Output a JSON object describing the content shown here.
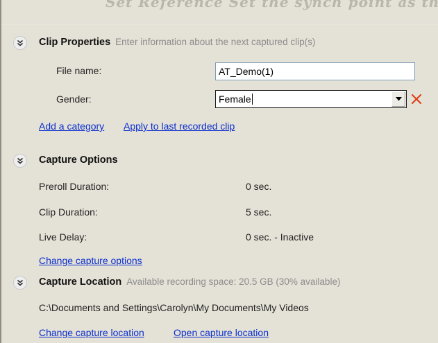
{
  "top_strip_text": "Set Reference    Set the synch point as th",
  "clip_properties": {
    "title": "Clip Properties",
    "hint": "Enter information about the next captured clip(s)",
    "file_name_label": "File name:",
    "file_name_value": "AT_Demo(1)",
    "gender_label": "Gender:",
    "gender_value": "Female",
    "add_category_link": "Add a category",
    "apply_last_link": "Apply to last recorded clip"
  },
  "capture_options": {
    "title": "Capture Options",
    "rows": [
      {
        "label": "Preroll Duration:",
        "value": "0 sec."
      },
      {
        "label": "Clip Duration:",
        "value": "5 sec."
      },
      {
        "label": "Live Delay:",
        "value": "0 sec. - Inactive"
      }
    ],
    "change_link": "Change capture options"
  },
  "capture_location": {
    "title": "Capture Location",
    "hint": "Available recording space: 20.5 GB (30% available)",
    "path": "C:\\Documents and Settings\\Carolyn\\My Documents\\My Videos",
    "change_link": "Change capture location",
    "open_link": "Open capture location"
  },
  "colors": {
    "panel_bg": "#e4e1d6",
    "link": "#0b2fcf",
    "remove_x": "#e0401c",
    "hint_text": "#8c8c8c"
  },
  "icons": {
    "collapse": "double-chevron-down-icon",
    "remove": "red-x-icon",
    "dropdown": "triangle-down-icon"
  }
}
